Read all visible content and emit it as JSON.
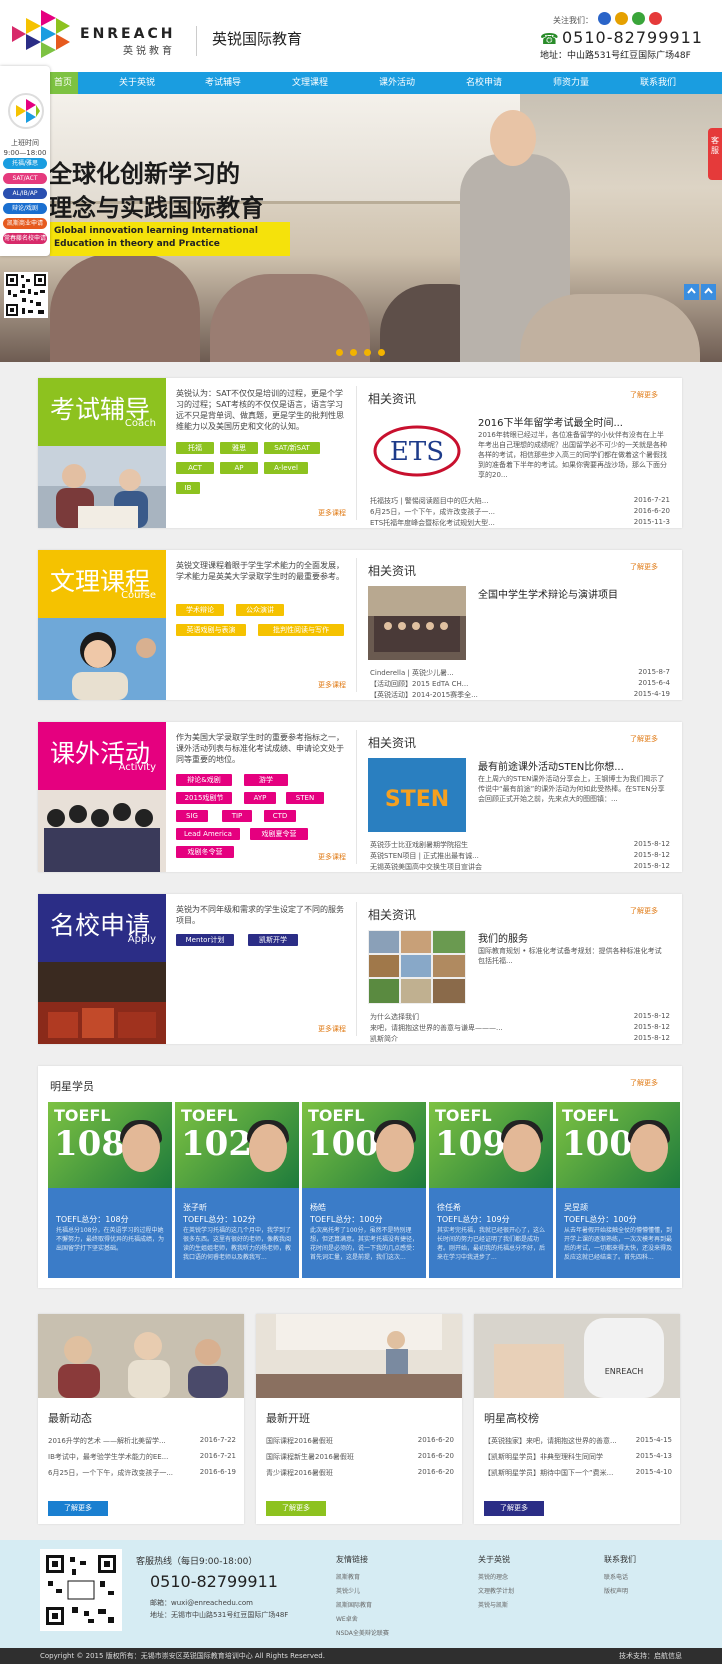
{
  "header": {
    "logo_en": "ENREACH",
    "logo_cn": "英锐教育",
    "site_name": "英锐国际教育",
    "follow_label": "关注我们：",
    "phone": "0510-82799911",
    "address": "地址：中山路531号红豆国际广场48F"
  },
  "nav": [
    "首页",
    "关于英锐",
    "考试辅导",
    "文理课程",
    "课外活动",
    "名校申请",
    "师资力量",
    "联系我们"
  ],
  "float_bar": {
    "time_label": "上班时间",
    "time": "9:00—18:00",
    "pills": [
      {
        "label": "托福/雅思",
        "color": "#1a9de0"
      },
      {
        "label": "SAT/ACT",
        "color": "#e53a7d"
      },
      {
        "label": "AL/IB/AP",
        "color": "#2a4fb0"
      },
      {
        "label": "辩论/戏剧",
        "color": "#1a6fd0"
      },
      {
        "label": "凯斯商业申请",
        "color": "#e65a1e"
      },
      {
        "label": "常春藤名校申请",
        "color": "#d72a6a"
      }
    ]
  },
  "hero": {
    "line1": "全球化创新学习的",
    "line2": "理念与实践国际教育",
    "en": "Global innovation learning International Education in theory and Practice"
  },
  "side_tab": "客服",
  "cards": [
    {
      "title": "考试辅导",
      "sub": "Coach",
      "color": "#8dc21f",
      "desc": "英锐认为：SAT不仅仅是培训的过程，更是个学习的过程；SAT考核的不仅仅是语言，语言学习远不只是背单词、做真题，更是学生的批判性思维能力以及美国历史和文化的认知。",
      "tags": [
        "托福",
        "雅思",
        "SAT/新SAT",
        "ACT",
        "AP",
        "A-level",
        "IB"
      ],
      "more": "更多课程",
      "rel": "相关资讯",
      "rmore": "了解更多",
      "ntitle": "2016下半年留学考试最全时间...",
      "nbody": "2016年转眼已经过半，各位准备留学的小伙伴有没有在上半年考出自己理想的成绩呢？出国留学必不可少的一关就是各种各样的考试，相信那些步入高三的同学们都在做着这个暑假找到的准备着下半年的考试。如果你需要再战沙场，那么下面分享的20...",
      "list": [
        [
          "托福技巧 | 警惕阅读题目中的匹大陷...",
          "2016-7-21"
        ],
        [
          "6月25日，一个下午，成许改变孩子一...",
          "2016-6-20"
        ],
        [
          "ETS托福年度峰会暨标化考试规划大型...",
          "2015-11-3"
        ]
      ]
    },
    {
      "title": "文理课程",
      "sub": "Course",
      "color": "#f5c200",
      "desc": "英锐文理课程着眼于学生学术能力的全面发展，学术能力是英美大学录取学生时的最重要参考。",
      "tags": [
        "学术辩论",
        "公众演讲",
        "英语戏剧与表演",
        "批判性阅读与写作"
      ],
      "more": "更多课程",
      "rel": "相关资讯",
      "rmore": "了解更多",
      "ntitle": "全国中学生学术辩论与演讲项目",
      "nbody": "",
      "list": [
        [
          "Cinderella | 英锐少儿暑...",
          "2015-8-7"
        ],
        [
          "【活动回顾】2015 EdTA CH...",
          "2015-6-4"
        ],
        [
          "【英锐活动】2014-2015赛季全...",
          "2015-4-19"
        ]
      ]
    },
    {
      "title": "课外活动",
      "sub": "Activity",
      "color": "#e5007f",
      "desc": "作为美国大学录取学生时的重要参考指标之一，课外活动列表与标准化考试成绩、申请论文处于同等重要的地位。",
      "tags": [
        "辩论&戏剧",
        "游学",
        "2015戏剧节",
        "AYP",
        "STEN",
        "SIG",
        "TIP",
        "CTD",
        "Lead America",
        "戏剧夏令营",
        "戏剧冬令营"
      ],
      "more": "更多课程",
      "rel": "相关资讯",
      "rmore": "了解更多",
      "ntitle": "最有前途课外活动STEN比你想...",
      "nbody": "在上周六的STEN课外活动分享会上，王钢博士为我们揭示了传说中“最有前途”的课外活动为何如此受热棒。在STEN分享会回顾正式开始之前，先来点大的图图镇：...",
      "list": [
        [
          "英锐莎士比亚戏剧暑期学院招生",
          "2015-8-12"
        ],
        [
          "英锐STEN项目 | 正式推出最有诚...",
          "2015-8-12"
        ],
        [
          "无锡英锐美国高中交换生项目宣讲会",
          "2015-8-12"
        ]
      ]
    },
    {
      "title": "名校申请",
      "sub": "Apply",
      "color": "#2b2d86",
      "desc": "英锐为不同年级和需求的学生设定了不同的服务项目。",
      "tags": [
        "Mentor计划",
        "凯斯开学"
      ],
      "more": "更多课程",
      "rel": "相关资讯",
      "rmore": "了解更多",
      "ntitle": "我们的服务",
      "nbody": "国际教育规划 • 标准化考试备考规划：提供各种标准化考试包括托福...",
      "list": [
        [
          "为什么选择我们",
          "2015-8-12"
        ],
        [
          "来吧，请拥抱这世界的善意与谦卑———...",
          "2015-8-12"
        ],
        [
          "凯斯简介",
          "2015-8-12"
        ]
      ]
    }
  ],
  "stars": {
    "title": "明星学员",
    "more": "了解更多",
    "items": [
      {
        "toefl": "TOEFL",
        "score": "108",
        "name": "",
        "sc": "TOEFL总分：108分",
        "desc": "托福总分108分，在英语学习的过程中她不懈努力，最终取得优异的托福成绩，为出国留学打下坚实基础。"
      },
      {
        "toefl": "TOEFL",
        "score": "102",
        "name": "张子昕",
        "sc": "TOEFL总分：102分",
        "desc": "在英锐学习托福的这几个月中，我学到了很多东西。这里有很好的老师，像教我阅读的生姐姐老师，教我听力的杨老师，教我口语的何睿老师以及教我写..."
      },
      {
        "toefl": "TOEFL",
        "score": "100",
        "name": "杨皓",
        "sc": "TOEFL总分：100分",
        "desc": "此次高托考了100分，虽然不是特别理想，但还算满意。其实考托福没有捷径，花时间是必须的，说一下我的几点感受：首先词汇量，这是前提，我们这次..."
      },
      {
        "toefl": "TOEFL",
        "score": "109",
        "name": "徐任希",
        "sc": "TOEFL总分：109分",
        "desc": "其实考完托福，我就已经很开心了，这么长时间的努力已经证明了我们都是成功者。刚开始，最初我的托福总分不好，后来在学习中我进步了..."
      },
      {
        "toefl": "TOEFL",
        "score": "100",
        "name": "吴昱颉",
        "sc": "TOEFL总分：100分",
        "desc": "从去年暑假开始接触全仗的懵懵懂懂，到开学上课的逐渐熟练，一次次模考再到最后的考试，一切都来得太快，还没来得及反应这就已经结束了。首先四科..."
      }
    ]
  },
  "boxes": [
    {
      "title": "最新动态",
      "btn": "了解更多",
      "btn_color": "#1a7fd0",
      "list": [
        [
          "2016升学的艺术 ——解析北美留学...",
          "2016-7-22"
        ],
        [
          "IB考试中，最考验学生学术能力的EE...",
          "2016-7-21"
        ],
        [
          "6月25日，一个下午，成许改变孩子一...",
          "2016-6-19"
        ]
      ]
    },
    {
      "title": "最新开班",
      "btn": "了解更多",
      "btn_color": "#8dc21f",
      "list": [
        [
          "国际课程2016暑假班",
          "2016-6-20"
        ],
        [
          "国际课程新生暑2016暑假班",
          "2016-6-20"
        ],
        [
          "青少课程2016暑假班",
          "2016-6-20"
        ]
      ]
    },
    {
      "title": "明星高校榜",
      "btn": "了解更多",
      "btn_color": "#2b2d86",
      "list": [
        [
          "【英锐独家】来吧，请拥抱这世界的善意...",
          "2015-4-15"
        ],
        [
          "【凯斯明星学员】非典型理科生同同学",
          "2015-4-13"
        ],
        [
          "【凯斯明星学员】期待中国下一个”费米...",
          "2015-4-10"
        ]
      ]
    }
  ],
  "footer": {
    "hot": "客服热线（每日9:00-18:00）",
    "phone": "0510-82799911",
    "email": "邮箱：wuxi@enreachedu.com",
    "addr": "地址：无锡市中山路531号红豆国际广场48F",
    "cols": [
      {
        "h": "友情链接",
        "items": [
          "凯斯教育",
          "英锐少儿",
          "凯斯国际教育",
          "WE卓舍",
          "NSDA全美辩论联赛"
        ]
      },
      {
        "h": "关于英锐",
        "items": [
          "英锐的理念",
          "文理教学计划",
          "英锐与凯斯"
        ]
      },
      {
        "h": "联系我们",
        "items": [
          "联系电话",
          "版权声明"
        ]
      }
    ],
    "copy": "Copyright © 2015 版权所有：无锡市崇安区英锐国际教育培训中心 All Rights Reserved.",
    "tech": "技术支持：启航信息"
  }
}
